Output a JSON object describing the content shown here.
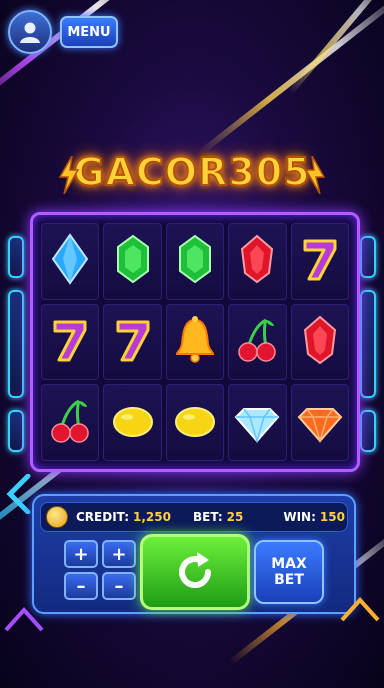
{
  "header": {
    "menu_label": "MENU"
  },
  "logo": {
    "text": "GACOR305"
  },
  "reels": {
    "rows": [
      [
        "blue-diamond-gem",
        "green-emerald-gem",
        "green-emerald-gem",
        "red-ruby-gem",
        "seven"
      ],
      [
        "seven",
        "seven",
        "golden-bell",
        "cherries",
        "red-ruby-gem"
      ],
      [
        "cherries",
        "lemon",
        "lemon",
        "diamond",
        "orange-gem"
      ]
    ]
  },
  "panel": {
    "credit_label": "CREDIT:",
    "credit_value": "1,250",
    "bet_label": "BET:",
    "bet_value": "25",
    "win_label": "WIN:",
    "win_value": "150",
    "plus_symbol": "+",
    "minus_symbol": "–",
    "maxbet_line1": "MAX",
    "maxbet_line2": "BET"
  },
  "colors": {
    "accent_purple": "#b55cff",
    "gold": "#ffd23a",
    "spin_green": "#3ccc28",
    "panel_blue": "#1e3ea8"
  }
}
